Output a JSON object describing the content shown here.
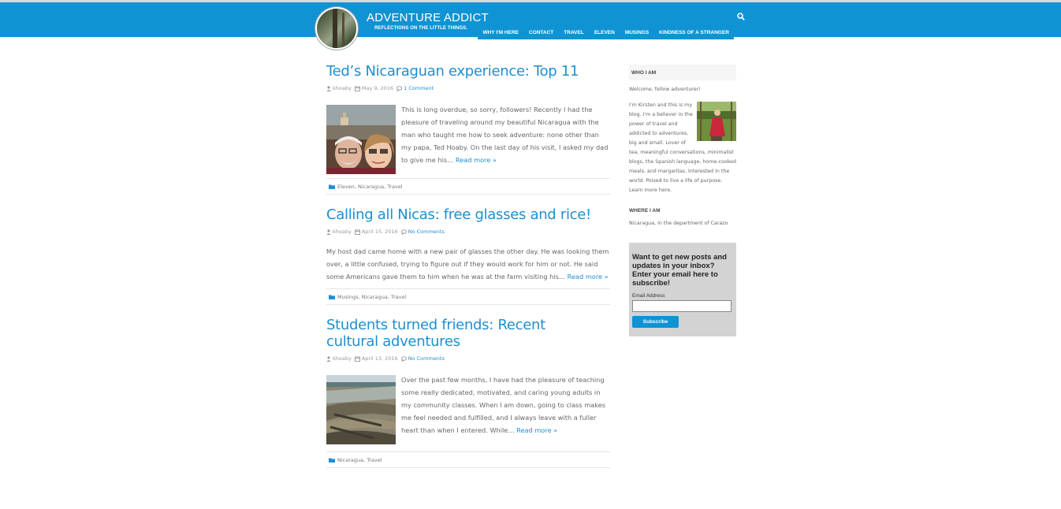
{
  "site": {
    "title": "ADVENTURE ADDICT",
    "tagline": "REFLECTIONS ON THE LITTLE THINGS."
  },
  "nav": {
    "items": [
      {
        "label": "WHY I'M HERE"
      },
      {
        "label": "CONTACT"
      },
      {
        "label": "TRAVEL"
      },
      {
        "label": "ELEVEN"
      },
      {
        "label": "MUSINGS"
      },
      {
        "label": "KINDNESS OF A STRANGER"
      }
    ]
  },
  "posts": [
    {
      "title": "Ted’s Nicaraguan experience: Top 11",
      "author": "khoaby",
      "date": "May 9, 2016",
      "comments": "1 Comment",
      "excerpt": "This is long overdue, so sorry, followers! Recently I had the pleasure of traveling around my beautiful Nicaragua with the man who taught me how to seek adventure: none other than my papa, Ted Hoaby. On the last day of his visit, I asked my dad to give me his…",
      "read_more": "Read more »",
      "categories": "Eleven, Nicaragua, Travel"
    },
    {
      "title": "Calling all Nicas: free glasses and rice!",
      "author": "khoaby",
      "date": "April 15, 2016",
      "comments": "No Comments",
      "excerpt": "My host dad came home with a new pair of glasses the other day. He was looking them over, a little confused, trying to figure out if they would work for him or not. He said some Americans gave them to him when he was at the farm visiting his…",
      "read_more": "Read more »",
      "categories": "Musings, Nicaragua, Travel"
    },
    {
      "title": "Students turned friends: Recent cultural adventures",
      "author": "khoaby",
      "date": "April 13, 2016",
      "comments": "No Comments",
      "excerpt": "Over the past few months, I have had the pleasure of teaching some really dedicated, motivated, and caring young adults in my community classes. When I am down, going to class makes me feel needed and fulfilled, and I always leave with a fuller heart than when I entered. While…",
      "read_more": "Read more »",
      "categories": "Nicaragua, Travel"
    }
  ],
  "sidebar": {
    "who_heading": "WHO I AM",
    "welcome": "Welcome, fellow adventurer!",
    "bio": "I'm Kirsten and this is my blog. I'm a believer in the power of travel and addicted to adventures, big and small. Lover of tea, meaningful conversations, minimalist blogs, the Spanish language, home-cooked meals, and margaritas. Interested in the world. Poised to live a life of purpose.",
    "learn_more": "Learn more here.",
    "where_heading": "WHERE I AM",
    "where_text": "Nicaragua, in the department of Carazo"
  },
  "subscribe": {
    "title": "Want to get new posts and updates in your inbox? Enter your email here to subscribe!",
    "email_label": "Email Address",
    "email_value": "",
    "button": "Subscribe"
  },
  "colors": {
    "accent": "#0f93d3",
    "link": "#1e8fcf"
  },
  "icons": [
    "search-icon",
    "user-icon",
    "calendar-icon",
    "comment-icon",
    "folder-icon"
  ]
}
